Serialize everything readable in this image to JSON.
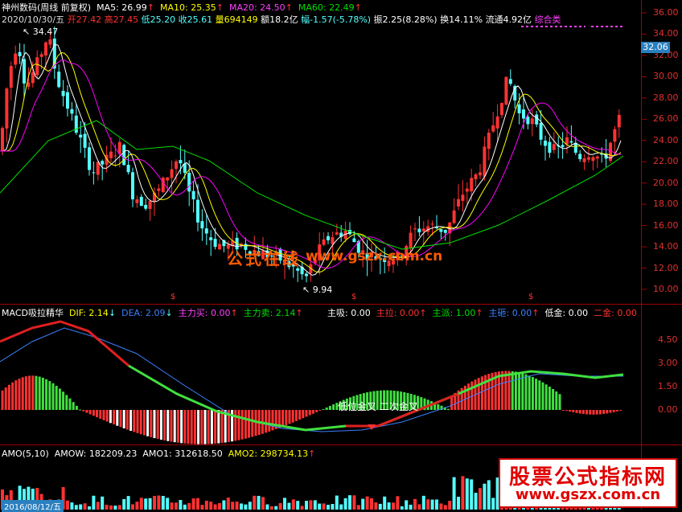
{
  "header": {
    "title": "神州数码(周线 前复权)",
    "ma5": "MA5: 26.99",
    "ma10": "MA10: 25.35",
    "ma20": "MA20: 24.50",
    "ma60": "MA60: 22.49",
    "date": "2020/10/30/五",
    "open": "开27.42",
    "high": "高27.45",
    "low": "低25.20",
    "close": "收25.61",
    "volume": "量694149",
    "amount": "额18.2亿",
    "change": "幅-1.57(-5.78%)",
    "amplitude": "振2.25(8.28%)",
    "turnover": "换14.11%",
    "float": "流通4.92亿",
    "category": "综合类"
  },
  "price_axis": [
    "36.00",
    "34.00",
    "32.00",
    "30.00",
    "28.00",
    "26.00",
    "24.00",
    "22.00",
    "20.00",
    "18.00",
    "16.00",
    "14.00",
    "12.00",
    "10.00"
  ],
  "current_price": "32.06",
  "markers": {
    "high": "34.47",
    "low": "9.94"
  },
  "watermark": {
    "cn": "公式在线",
    "url": "www.gszx.com.cn"
  },
  "macd_panel": {
    "title": "MACD吸拉精华",
    "dif": "DIF: 2.14",
    "dea": "DEA: 2.09",
    "zlm": "主力买: 0.00",
    "zlmai": "主力卖: 2.14",
    "zx": "主吸: 0.00",
    "zl": "主拉: 0.00",
    "zp": "主派: 1.00",
    "zz": "主砸: 0.00",
    "dj": "低金: 0.00",
    "ej": "二金: 0.00",
    "axis": [
      "4.50",
      "3.00",
      "1.50",
      "0.00"
    ],
    "annotation": "低位金叉 二次金叉"
  },
  "amo_panel": {
    "title": "AMO(5,10)",
    "amow": "AMOW: 182209.23",
    "amo1": "AMO1: 312618.50",
    "amo2": "AMO2: 298734.13",
    "date_label": "2016/08/12/五"
  },
  "brand": {
    "title": "股票公式指标网",
    "url": "www.gszx.com.cn"
  },
  "colors": {
    "up": "#ff3232",
    "down": "#54ffff",
    "ma5": "#ffffff",
    "ma10": "#ffff00",
    "ma20": "#ff00ff",
    "ma60": "#00e000",
    "dif": "#ff2020",
    "dea": "#3a80ff"
  }
}
